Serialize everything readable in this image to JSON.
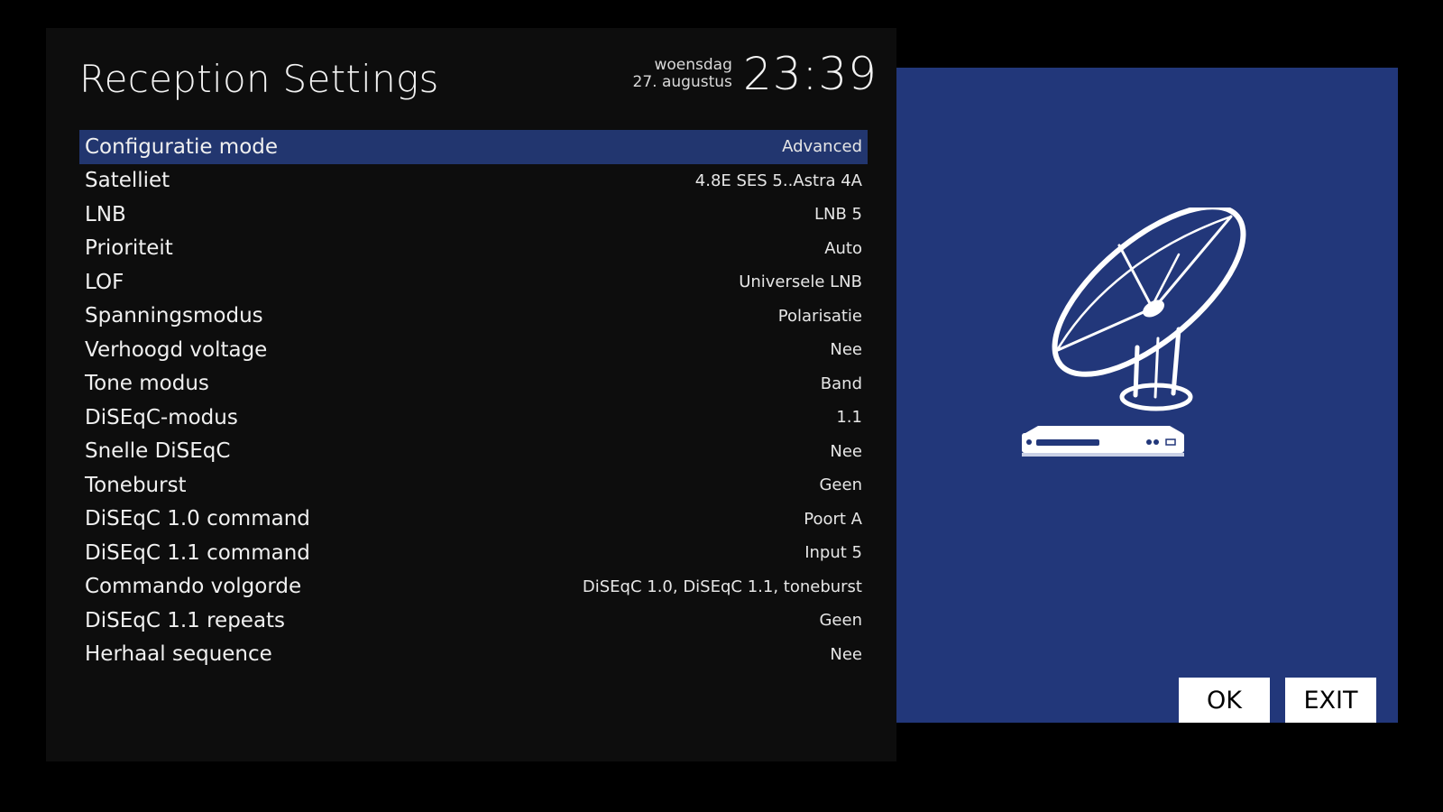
{
  "header": {
    "title": "Reception Settings",
    "weekday": "woensdag",
    "date": "27. augustus",
    "time": "23:39"
  },
  "settings": [
    {
      "label": "Configuratie mode",
      "value": "Advanced",
      "selected": true
    },
    {
      "label": "Satelliet",
      "value": "4.8E SES 5..Astra 4A"
    },
    {
      "label": "LNB",
      "value": "LNB 5"
    },
    {
      "label": "Prioriteit",
      "value": "Auto"
    },
    {
      "label": "LOF",
      "value": "Universele LNB"
    },
    {
      "label": "Spanningsmodus",
      "value": "Polarisatie"
    },
    {
      "label": "Verhoogd voltage",
      "value": "Nee"
    },
    {
      "label": "Tone modus",
      "value": "Band"
    },
    {
      "label": "DiSEqC-modus",
      "value": "1.1"
    },
    {
      "label": "Snelle DiSEqC",
      "value": "Nee"
    },
    {
      "label": "Toneburst",
      "value": "Geen"
    },
    {
      "label": "DiSEqC 1.0 command",
      "value": "Poort A"
    },
    {
      "label": "DiSEqC 1.1 command",
      "value": "Input 5"
    },
    {
      "label": "Commando volgorde",
      "value": "DiSEqC 1.0, DiSEqC 1.1, toneburst"
    },
    {
      "label": "DiSEqC 1.1 repeats",
      "value": "Geen"
    },
    {
      "label": "Herhaal sequence",
      "value": "Nee"
    }
  ],
  "side_panel": {
    "illustration": "satellite-dish-with-receiver-icon"
  },
  "buttons": {
    "ok_label": "OK",
    "exit_label": "EXIT"
  },
  "colors": {
    "background": "#000000",
    "panel": "#0d0d0d",
    "highlight": "#22366f",
    "side_panel": "#22377a",
    "text": "#ffffff"
  }
}
